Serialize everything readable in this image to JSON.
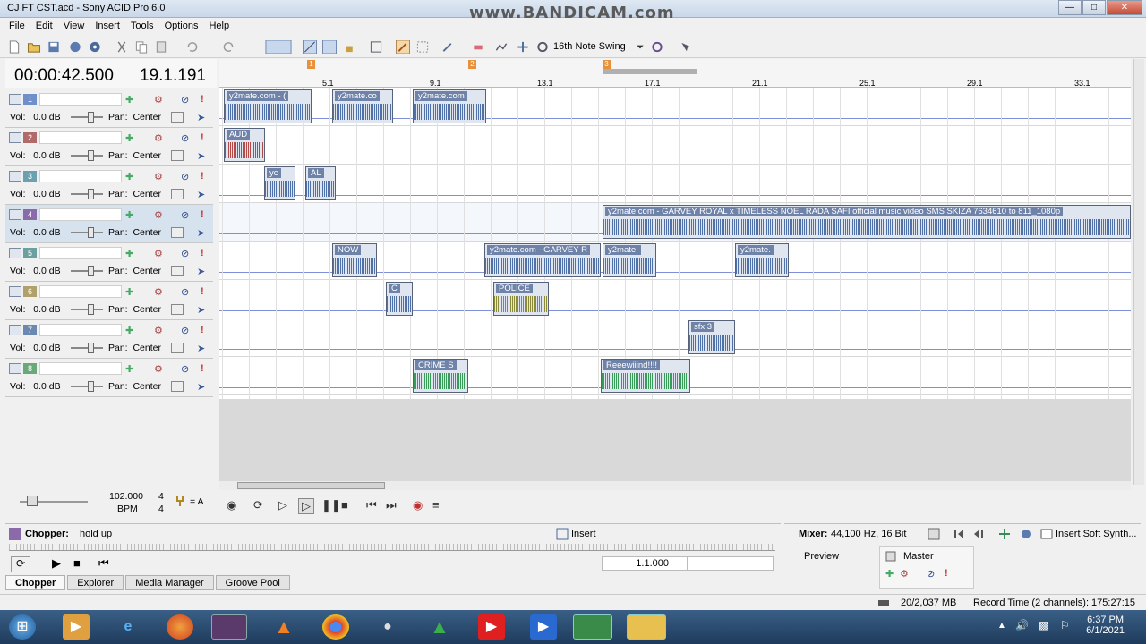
{
  "window": {
    "title": "CJ FT CST.acd - Sony ACID Pro 6.0",
    "watermark": "www.BANDICAM.com"
  },
  "menu": [
    "File",
    "Edit",
    "View",
    "Insert",
    "Tools",
    "Options",
    "Help"
  ],
  "toolbar": {
    "swing_label": "16th Note Swing"
  },
  "time": {
    "clock": "00:00:42.500",
    "measure": "19.1.191"
  },
  "tracks": [
    {
      "num": "1",
      "vol": "Vol:",
      "vol_value": "0.0 dB",
      "pan": "Pan:",
      "pan_value": "Center",
      "color": "#6f8fc8"
    },
    {
      "num": "2",
      "vol": "Vol:",
      "vol_value": "0.0 dB",
      "pan": "Pan:",
      "pan_value": "Center",
      "color": "#b06a6a"
    },
    {
      "num": "3",
      "vol": "Vol:",
      "vol_value": "0.0 dB",
      "pan": "Pan:",
      "pan_value": "Center",
      "color": "#6aa0b0"
    },
    {
      "num": "4",
      "vol": "Vol:",
      "vol_value": "0.0 dB",
      "pan": "Pan:",
      "pan_value": "Center",
      "color": "#8a6aa8"
    },
    {
      "num": "5",
      "vol": "Vol:",
      "vol_value": "0.0 dB",
      "pan": "Pan:",
      "pan_value": "Center",
      "color": "#6aa0a0"
    },
    {
      "num": "6",
      "vol": "Vol:",
      "vol_value": "0.0 dB",
      "pan": "Pan:",
      "pan_value": "Center",
      "color": "#b0a06a"
    },
    {
      "num": "7",
      "vol": "Vol:",
      "vol_value": "0.0 dB",
      "pan": "Pan:",
      "pan_value": "Center",
      "color": "#6a88b0"
    },
    {
      "num": "8",
      "vol": "Vol:",
      "vol_value": "0.0 dB",
      "pan": "Pan:",
      "pan_value": "Center",
      "color": "#6aa87a"
    }
  ],
  "ruler": {
    "markers": [
      "1",
      "2",
      "3"
    ],
    "bars": [
      "5.1",
      "9.1",
      "13.1",
      "17.1",
      "21.1",
      "25.1",
      "29.1",
      "33.1"
    ]
  },
  "events": [
    {
      "label": "y2mate.com - (",
      "color": "blue"
    },
    {
      "label": "y2mate.co",
      "color": "blue"
    },
    {
      "label": "y2mate.com",
      "color": "blue"
    },
    {
      "label": "AUD",
      "color": "red"
    },
    {
      "label": "yc",
      "color": "blue"
    },
    {
      "label": "AL",
      "color": "blue"
    },
    {
      "label": "y2mate.com - GARVEY ROYAL x TIMELESS NOEL  RADA SAFI  official music video  SMS SKIZA 7634610  to 811_1080p",
      "color": "blue"
    },
    {
      "label": "NOW",
      "color": "blue"
    },
    {
      "label": "y2mate.com - GARVEY R",
      "color": "blue"
    },
    {
      "label": "y2mate.",
      "color": "blue"
    },
    {
      "label": "y2mate.",
      "color": "blue"
    },
    {
      "label": "C",
      "color": "blue"
    },
    {
      "label": "POLICE",
      "color": "olive"
    },
    {
      "label": "sfx 3",
      "color": "blue"
    },
    {
      "label": "CRIME S",
      "color": "green"
    },
    {
      "label": "Reeewiiind!!!!",
      "color": "green"
    }
  ],
  "tempo": {
    "bpm": "102.000",
    "bpm_label": "BPM",
    "sig_top": "4",
    "sig_bottom": "4",
    "key": "= A"
  },
  "chopper": {
    "label": "Chopper:",
    "value": "hold up",
    "insert": "Insert",
    "position": "1.1.000"
  },
  "tabs": [
    "Chopper",
    "Explorer",
    "Media Manager",
    "Groove Pool"
  ],
  "mixer": {
    "label": "Mixer:",
    "value": "44,100 Hz, 16 Bit",
    "insert_synth": "Insert Soft Synth...",
    "preview": "Preview",
    "master": "Master"
  },
  "status": {
    "memory": "20/2,037 MB",
    "record_time": "Record Time (2 channels): 175:27:15"
  },
  "clock": {
    "time": "6:37 PM",
    "date": "6/1/2021"
  }
}
